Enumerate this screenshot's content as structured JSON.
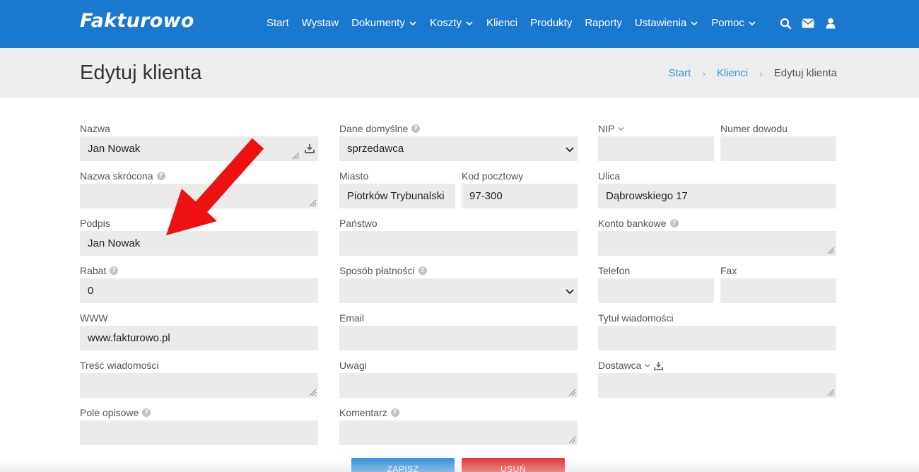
{
  "app": {
    "logo": "Fakturowo"
  },
  "nav": {
    "items": [
      {
        "label": "Start"
      },
      {
        "label": "Wystaw"
      },
      {
        "label": "Dokumenty"
      },
      {
        "label": "Koszty"
      },
      {
        "label": "Klienci"
      },
      {
        "label": "Produkty"
      },
      {
        "label": "Raporty"
      },
      {
        "label": "Ustawienia"
      },
      {
        "label": "Pomoc"
      }
    ],
    "icons": [
      "search-icon",
      "envelope-icon",
      "user-icon"
    ]
  },
  "page": {
    "title": "Edytuj klienta",
    "breadcrumb": {
      "home": "Start",
      "parent": "Klienci",
      "current": "Edytuj klienta"
    }
  },
  "form": {
    "nazwa": {
      "label": "Nazwa",
      "value": "Jan Nowak"
    },
    "nazwa_skrocona": {
      "label": "Nazwa skrócona",
      "value": ""
    },
    "podpis": {
      "label": "Podpis",
      "value": "Jan Nowak"
    },
    "rabat": {
      "label": "Rabat",
      "value": "0"
    },
    "www": {
      "label": "WWW",
      "value": "www.fakturowo.pl"
    },
    "tresc_wiadomosci": {
      "label": "Treść wiadomości",
      "value": ""
    },
    "pole_opisowe": {
      "label": "Pole opisowe",
      "value": ""
    },
    "dane_domyslne": {
      "label": "Dane domyślne",
      "value": "sprzedawca"
    },
    "miasto": {
      "label": "Miasto",
      "value": "Piotrków Trybunalski"
    },
    "kod_pocztowy": {
      "label": "Kod pocztowy",
      "value": "97-300"
    },
    "panstwo": {
      "label": "Państwo",
      "value": ""
    },
    "sposob_platnosci": {
      "label": "Sposób płatności",
      "value": ""
    },
    "email": {
      "label": "Email",
      "value": ""
    },
    "uwagi": {
      "label": "Uwagi",
      "value": ""
    },
    "komentarz": {
      "label": "Komentarz",
      "value": ""
    },
    "nip": {
      "label": "NIP",
      "value": ""
    },
    "numer_dowodu": {
      "label": "Numer dowodu",
      "value": ""
    },
    "ulica": {
      "label": "Ulica",
      "value": "Dąbrowskiego 17"
    },
    "konto_bankowe": {
      "label": "Konto bankowe",
      "value": ""
    },
    "telefon": {
      "label": "Telefon",
      "value": ""
    },
    "fax": {
      "label": "Fax",
      "value": ""
    },
    "tytul_wiadomosci": {
      "label": "Tytuł wiadomości",
      "value": ""
    },
    "dostawca": {
      "label": "Dostawca",
      "value": ""
    }
  },
  "actions": {
    "save": "ZAPISZ",
    "delete": "USUŃ"
  },
  "colors": {
    "navbar": "#1a78cf",
    "field_bg": "#ebebeb",
    "link": "#3a93d8",
    "arrow": "#ee1111",
    "save": "#3b96e0",
    "delete": "#e53a3a"
  }
}
